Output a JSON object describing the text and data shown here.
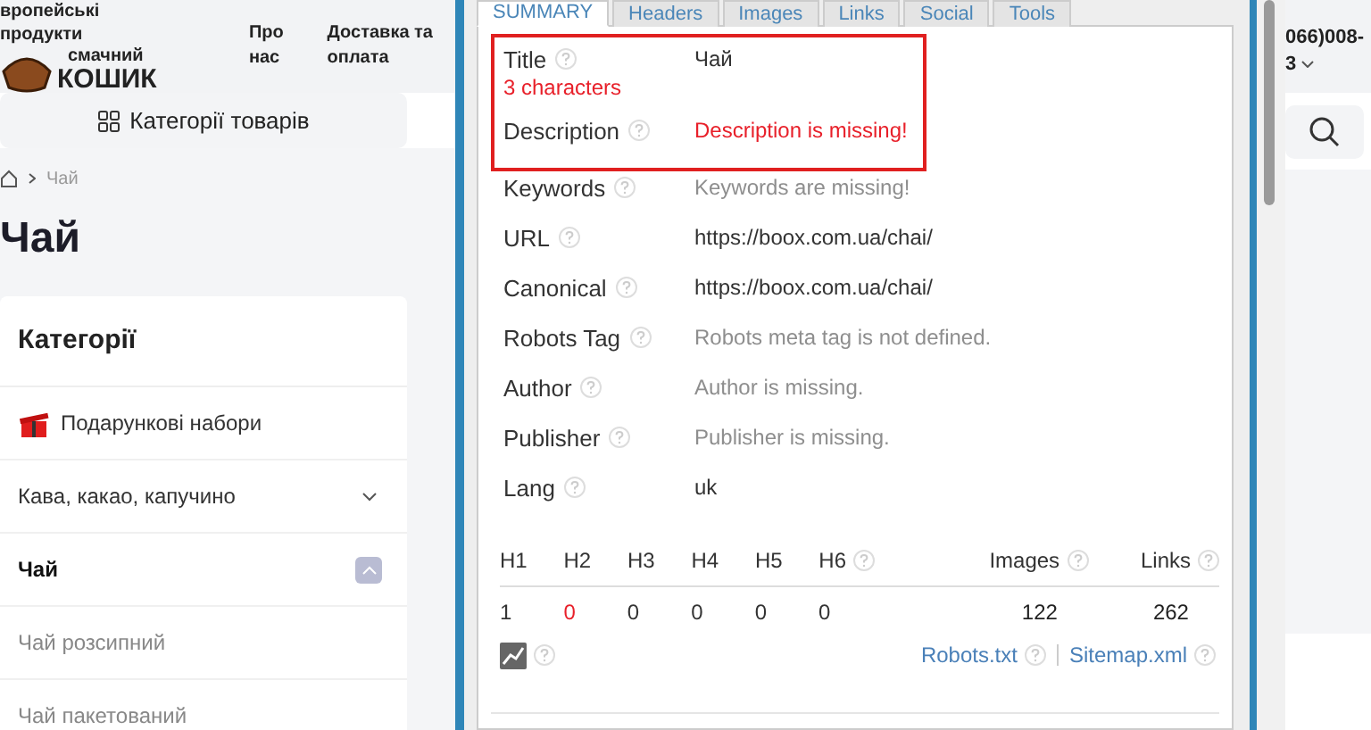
{
  "site": {
    "tagline": [
      "вропейські",
      "продукти"
    ],
    "logo": {
      "line1": "смачний",
      "line2": "КОШИК"
    },
    "nav": [
      "Про нас",
      "Доставка та оплата"
    ],
    "phone": [
      "066)008-",
      "3"
    ],
    "categories_button": "Категорії товарів",
    "breadcrumb": "Чай",
    "heading": "Чай",
    "sidebar": {
      "title": "Категорії",
      "items": [
        {
          "label": "Подарункові набори",
          "kind": "gift",
          "selected": false
        },
        {
          "label": "Кава, какао, капучино",
          "kind": "group",
          "expanded": false,
          "selected": false
        },
        {
          "label": "Чай",
          "kind": "group",
          "expanded": true,
          "selected": true
        },
        {
          "label": "Чай розсипний",
          "kind": "sub",
          "selected": false
        },
        {
          "label": "Чай пакетований",
          "kind": "sub",
          "selected": false
        }
      ]
    }
  },
  "popup": {
    "tabs": [
      {
        "label": "SUMMARY",
        "selected": true
      },
      {
        "label": "Headers",
        "selected": false
      },
      {
        "label": "Images",
        "selected": false
      },
      {
        "label": "Links",
        "selected": false
      },
      {
        "label": "Social",
        "selected": false
      },
      {
        "label": "Tools",
        "selected": false
      }
    ],
    "alert_fields": [
      {
        "label": "Title",
        "note": "3 characters",
        "value": "Чай",
        "error": false,
        "missing": false
      },
      {
        "label": "Description",
        "value": "Description is missing!",
        "error": true,
        "missing": false
      }
    ],
    "fields": [
      {
        "label": "Keywords",
        "value": "Keywords are missing!",
        "error": false,
        "missing": true
      },
      {
        "label": "URL",
        "value": "https://boox.com.ua/chai/",
        "error": false,
        "missing": false
      },
      {
        "label": "Canonical",
        "value": "https://boox.com.ua/chai/",
        "error": false,
        "missing": false
      },
      {
        "label": "Robots Tag",
        "value": "Robots meta tag is not defined.",
        "error": false,
        "missing": true
      },
      {
        "label": "Author",
        "value": "Author is missing.",
        "error": false,
        "missing": true
      },
      {
        "label": "Publisher",
        "value": "Publisher is missing.",
        "error": false,
        "missing": true
      },
      {
        "label": "Lang",
        "value": "uk",
        "error": false,
        "missing": false
      }
    ],
    "headings": [
      {
        "label": "H1",
        "value": "1",
        "error": false
      },
      {
        "label": "H2",
        "value": "0",
        "error": true
      },
      {
        "label": "H3",
        "value": "0",
        "error": false
      },
      {
        "label": "H4",
        "value": "0",
        "error": false
      },
      {
        "label": "H5",
        "value": "0",
        "error": false
      },
      {
        "label": "H6",
        "value": "0",
        "error": false
      }
    ],
    "counts": [
      {
        "label": "Images",
        "value": "122"
      },
      {
        "label": "Links",
        "value": "262"
      }
    ],
    "footer_links": [
      "Robots.txt",
      "Sitemap.xml"
    ]
  }
}
